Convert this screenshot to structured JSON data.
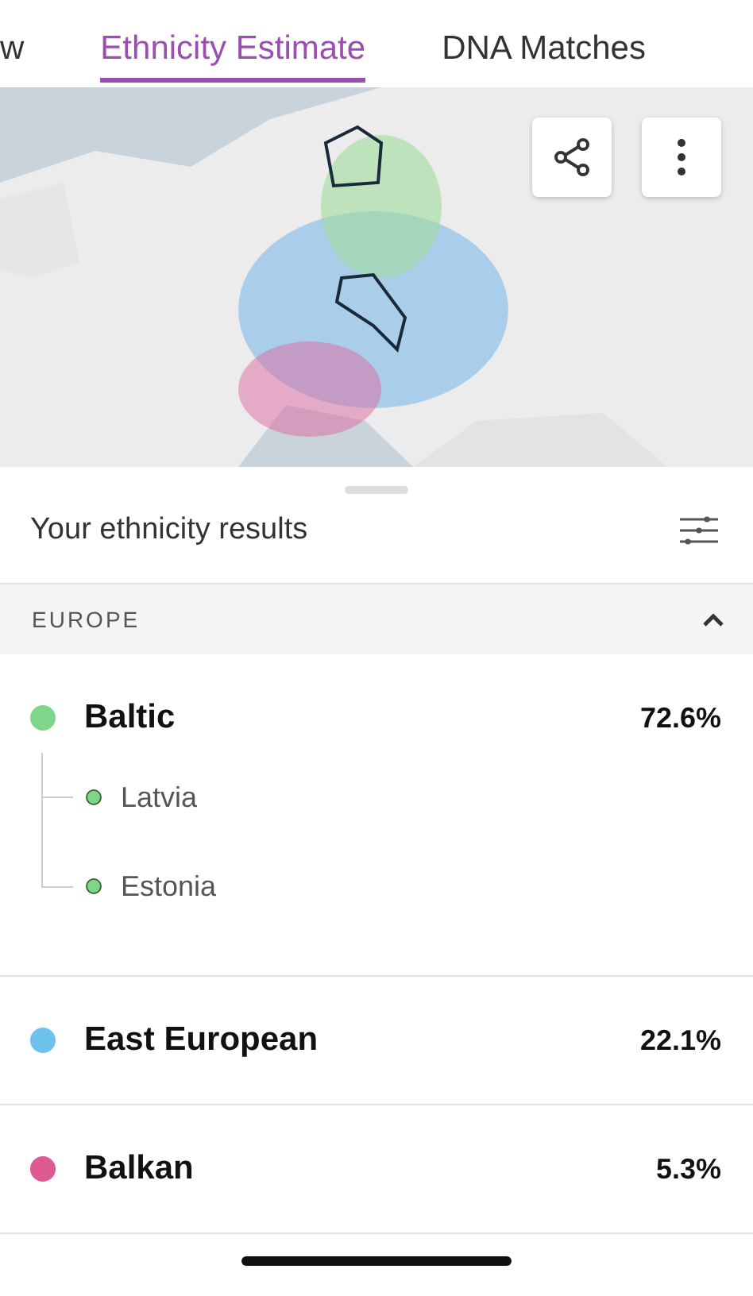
{
  "tabs": [
    {
      "label": "w",
      "selected": false
    },
    {
      "label": "Ethnicity Estimate",
      "selected": true
    },
    {
      "label": "DNA Matches",
      "selected": false
    }
  ],
  "results_header": {
    "title": "Your ethnicity results"
  },
  "section": {
    "title": "EUROPE",
    "expanded": true
  },
  "regions": [
    {
      "name": "Baltic",
      "percent": "72.6%",
      "color": "#7fd68a",
      "children": [
        {
          "name": "Latvia",
          "color": "#7fd68a"
        },
        {
          "name": "Estonia",
          "color": "#7fd68a"
        }
      ]
    },
    {
      "name": "East European",
      "percent": "22.1%",
      "color": "#6cc3ee"
    },
    {
      "name": "Balkan",
      "percent": "5.3%",
      "color": "#de5a93"
    }
  ]
}
